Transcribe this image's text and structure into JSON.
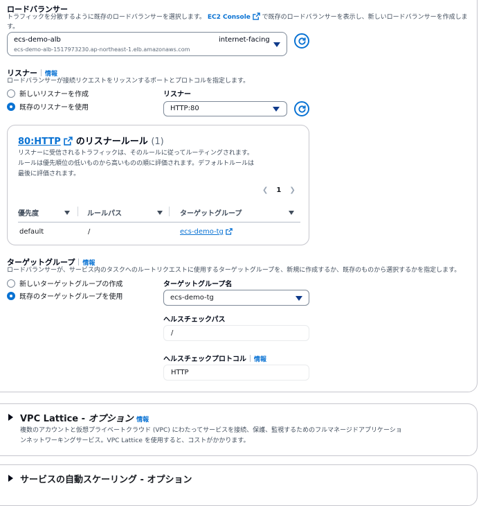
{
  "load_balancer": {
    "title": "ロードバランサー",
    "desc_prefix": "トラフィックを分散するように既存のロードバランサーを選択します。",
    "console_link": "EC2 Console",
    "desc_suffix": "で既存のロードバランサーを表示し、新しいロードバランサーを作成しま",
    "desc_wrap": "す。",
    "selected_name": "ecs-demo-alb",
    "selected_dns": "ecs-demo-alb-1517973230.ap-northeast-1.elb.amazonaws.com",
    "selected_scheme": "internet-facing"
  },
  "listener": {
    "title": "リスナー",
    "info": "情報",
    "desc": "ロードバランサーが接続リクエストをリッスンするポートとプロトコルを指定します。",
    "option_new": "新しいリスナーを作成",
    "option_existing": "既存のリスナーを使用",
    "select_label": "リスナー",
    "select_value": "HTTP:80"
  },
  "rules_panel": {
    "link": "80:HTTP",
    "title": "のリスナールール",
    "count": "(1)",
    "desc": [
      "リスナーに受信されるトラフィックは、そのルールに従ってルーティングされます。",
      "ルールは優先順位の低いものから高いものの順に評価されます。デフォルトルールは",
      "最後に評価されます。"
    ],
    "page": "1",
    "columns": [
      "優先度",
      "ルールパス",
      "ターゲットグループ"
    ],
    "rows": [
      {
        "priority": "default",
        "path": "/",
        "target": "ecs-demo-tg"
      }
    ]
  },
  "target_group": {
    "title": "ターゲットグループ",
    "info": "情報",
    "desc": "ロードバランサーが、サービス内のタスクへのルートリクエストに使用するターゲットグループを、新規に作成するか、既存のものから選択するかを指定します。",
    "option_new": "新しいターゲットグループの作成",
    "option_existing": "既存のターゲットグループを使用",
    "name_label": "ターゲットグループ名",
    "name_value": "ecs-demo-tg",
    "health_path_label": "ヘルスチェックパス",
    "health_path_value": "/",
    "health_protocol_label": "ヘルスチェックプロトコル",
    "health_protocol_info": "情報",
    "health_protocol_value": "HTTP"
  },
  "vpc_lattice": {
    "title": "VPC Lattice - ",
    "title_italic": "オプション",
    "info": "情報",
    "desc": [
      "複数のアカウントと仮想プライベートクラウド (VPC) にわたってサービスを接続、保護、監視するためのフルマネージドアプリケーショ",
      "ンネットワーキングサービス。VPC Lattice を使用すると、コストがかかります。"
    ]
  },
  "autoscaling": {
    "title": "サービスの自動スケーリング - オプション"
  }
}
